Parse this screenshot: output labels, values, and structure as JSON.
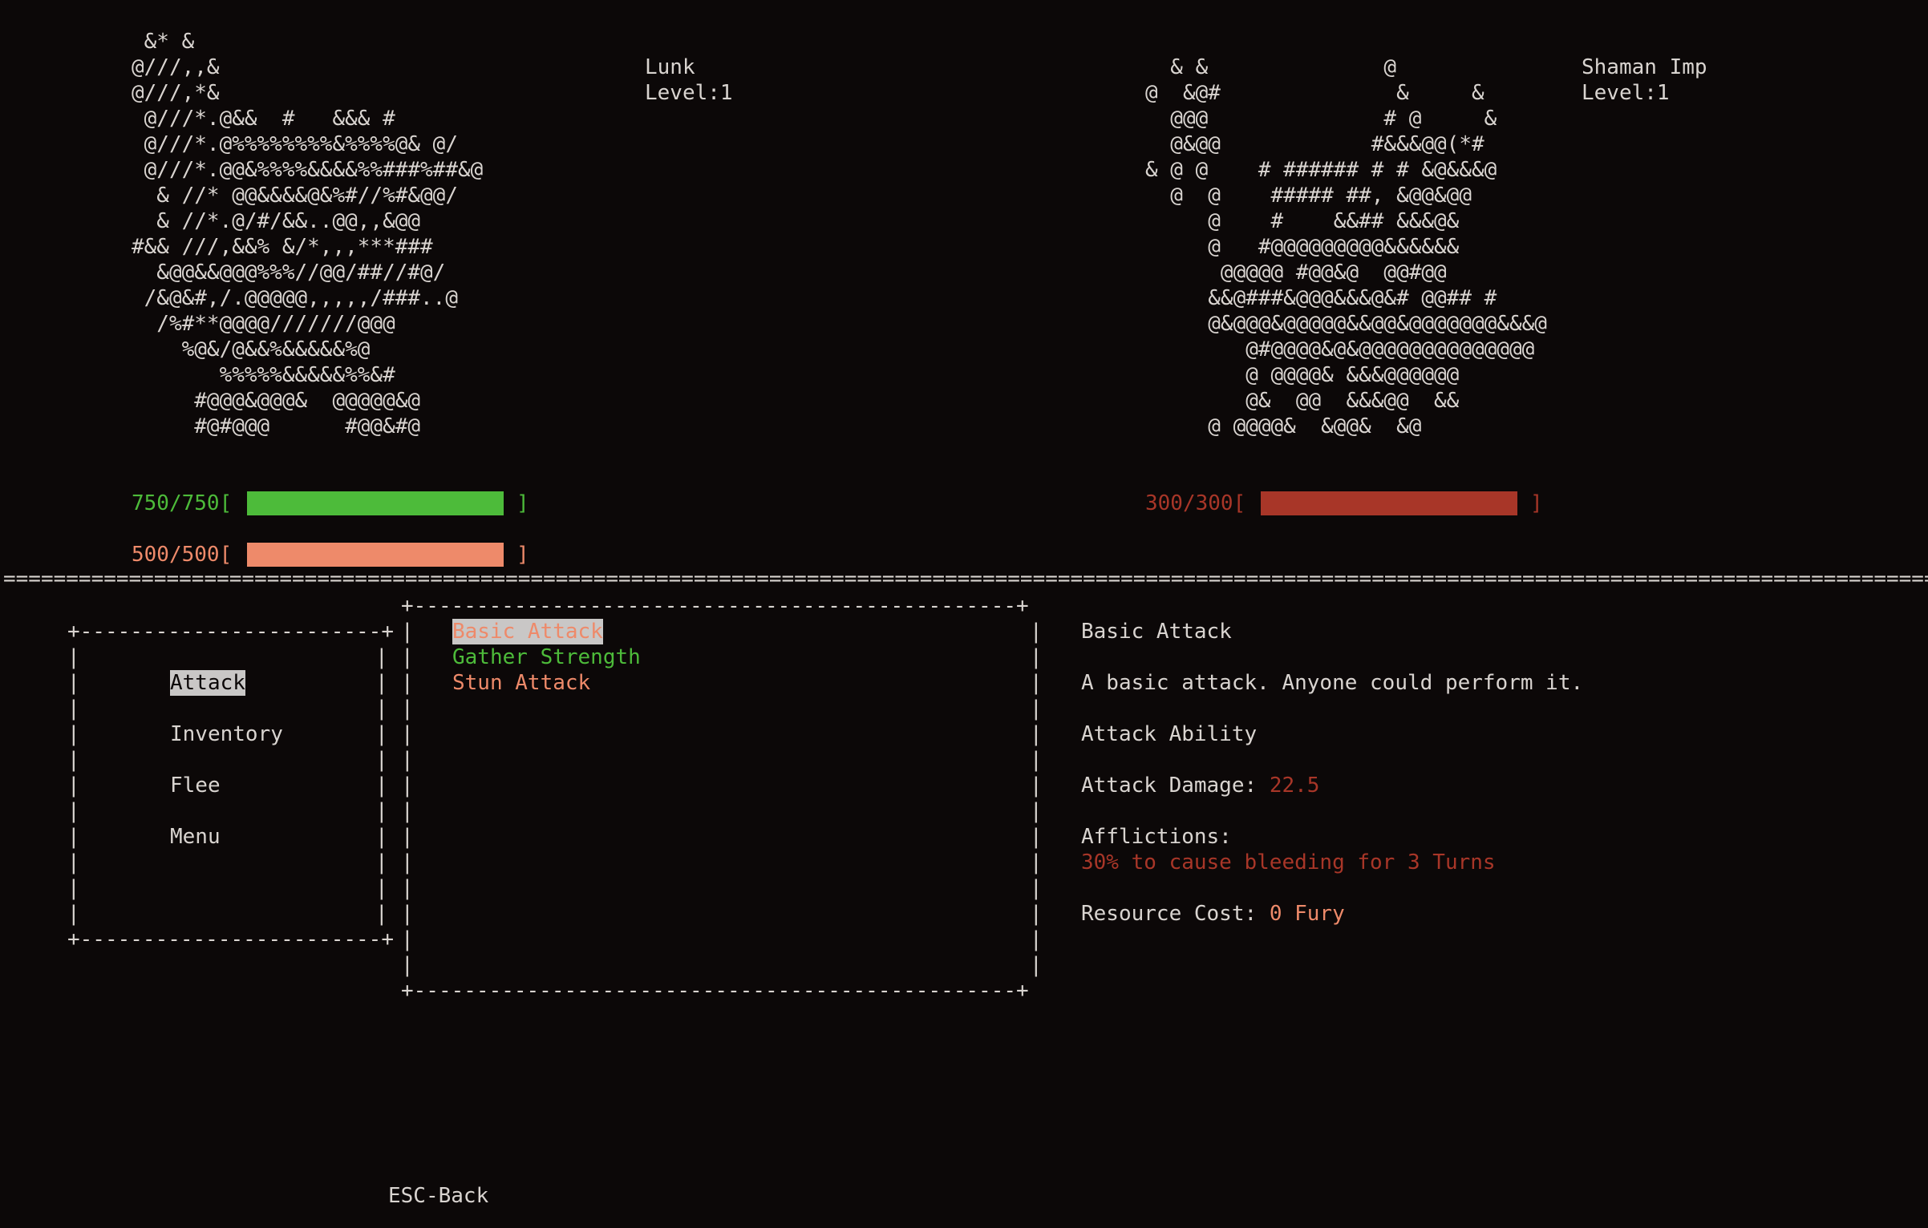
{
  "player": {
    "name": "Lunk",
    "level": "Level:1",
    "art": " &* &\n@///,,&\n@///,*&\n @///*.@&&  #   &&& #\n @///*.@%%%%%%%%&%%%%@& @/\n @///*.@@&%%%%&&&&%%###%##&@\n  & //* @@&&&&@&%#//%#&@@/\n  & //*.@/#/&&..@@,,&@@\n#&& ///,&&% &/*,,,***###\n  &@@&&@@@%%%//@@/##//#@/\n /&@&#,/.@@@@@,,,,,/###..@\n  /%#**@@@@///////@@@\n    %@&/@&&%&&&&&%@\n       %%%%%&&&&&%%&#\n     #@@@&@@@&  @@@@@&@\n     #@#@@@      #@@&#@",
    "hp_text": "750/750[",
    "hp_fraction": 1.0,
    "resource_text": "500/500[",
    "resource_fraction": 1.0,
    "bar_close": "]"
  },
  "enemy": {
    "name": "Shaman Imp",
    "level": "Level:1",
    "art": "  & &              @\n@  &@#              &     &\n  @@@              # @     &\n  @&@@            #&&&@@(*#\n& @ @    # ###### # # &@&&&@\n  @  @    ##### ##, &@@&@@\n     @    #    &&## &&&@&\n     @   #@@@@@@@@@&&&&&&\n      @@@@@ #@@&@  @@#@@\n     &&@###&@@@&&&@&# @@## #\n     @&@@@&@@@@@&&@@&@@@@@@@&&&@\n        @#@@@@&@&@@@@@@@@@@@@@@\n        @ @@@@& &&&@@@@@@\n        @&  @@  &&&@@  &&\n     @ @@@@&  &@@&  &@",
    "hp_text": "300/300[",
    "hp_fraction": 1.0,
    "bar_close": "]"
  },
  "divider": "==============================================================================================================================================================",
  "menu": {
    "box_top": "+------------------------+",
    "box_bottom": "+------------------------+",
    "items": [
      "Attack",
      "Inventory",
      "Flee",
      "Menu"
    ],
    "selected": "Attack"
  },
  "abilities": {
    "box_top": "+------------------------------------------------+",
    "box_bottom": "+------------------------------------------------+",
    "items": [
      "Basic Attack",
      "Gather Strength",
      "Stun Attack"
    ],
    "selected": "Basic Attack"
  },
  "details": {
    "title": "Basic Attack",
    "description": "A basic attack. Anyone could perform it.",
    "type": "Attack Ability",
    "damage_label": "Attack Damage:",
    "damage_value": "22.5",
    "afflictions_label": "Afflictions:",
    "affliction": "30% to cause bleeding for 3 Turns",
    "cost_label": "Resource Cost:",
    "cost_value": "0 Fury"
  },
  "footer": {
    "hint": "ESC-Back"
  },
  "colors": {
    "background": "#0c0808",
    "text": "#d9d4d0",
    "health_player": "#4dbb3a",
    "resource_player": "#ee8a6a",
    "health_enemy": "#a83628",
    "highlight": "#c9c7c6"
  }
}
